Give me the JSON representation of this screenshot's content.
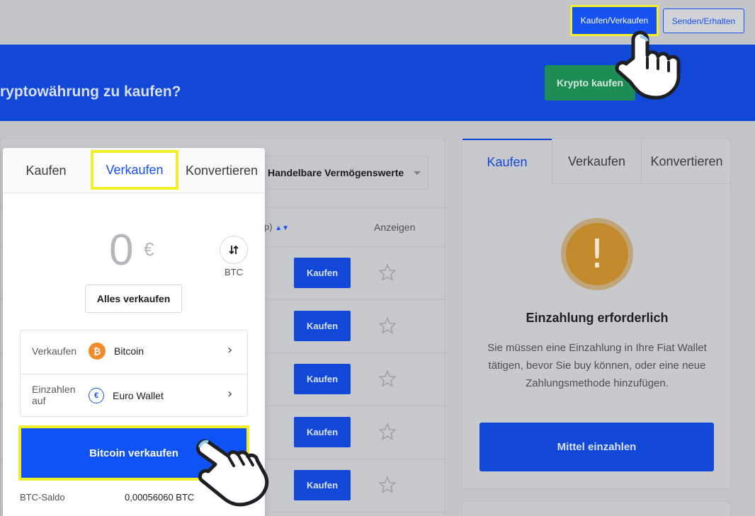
{
  "header": {
    "buy_sell": "Kaufen/Verkaufen",
    "send_receive": "Senden/Erhalten"
  },
  "banner": {
    "title": "ryptowährung zu kaufen?",
    "buy_crypto": "Krypto kaufen"
  },
  "assets": {
    "filter": "Handelbare Vermögenswerte",
    "col_change": "p)",
    "col_show": "Anzeigen",
    "rows": [
      {
        "buy": "Kaufen"
      },
      {
        "buy": "Kaufen"
      },
      {
        "buy": "Kaufen"
      },
      {
        "buy": "Kaufen"
      },
      {
        "buy": "Kaufen"
      }
    ]
  },
  "right_panel": {
    "tabs": [
      "Kaufen",
      "Verkaufen",
      "Konvertieren"
    ],
    "warning_symbol": "!",
    "heading": "Einzahlung erforderlich",
    "text": "Sie müssen eine Einzahlung in Ihre Fiat Wallet tätigen, bevor Sie buy können, oder eine neue Zahlungsmethode hinzufügen.",
    "deposit": "Mittel einzahlen"
  },
  "popup": {
    "tabs": [
      "Kaufen",
      "Verkaufen",
      "Konvertieren"
    ],
    "amount": "0",
    "currency": "€",
    "swap_label": "BTC",
    "sell_all": "Alles verkaufen",
    "sell_label": "Verkaufen",
    "sell_asset": "Bitcoin",
    "deposit_label": "Einzahlen auf",
    "deposit_target": "Euro Wallet",
    "sell_button": "Bitcoin verkaufen",
    "balance_label": "BTC-Saldo",
    "balance_value": "0,00056060 BTC"
  },
  "colors": {
    "accent": "#1652f0",
    "highlight": "#f4ee2a",
    "warning": "#c28a2a"
  }
}
